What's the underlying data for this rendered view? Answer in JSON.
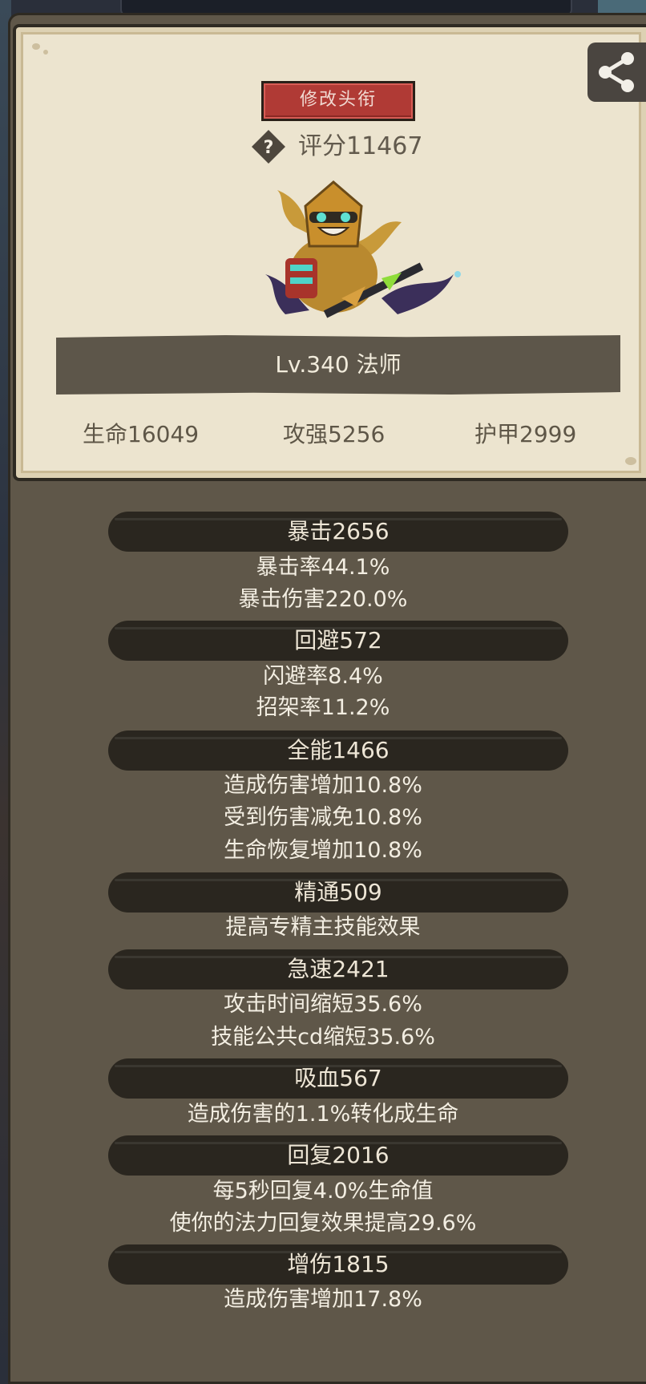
{
  "header": {
    "title_button": "修改头衔",
    "score_text": "评分11467"
  },
  "hero": {
    "level_class": "Lv.340 法师",
    "life": "生命16049",
    "attack": "攻强5256",
    "armor": "护甲2999"
  },
  "stats": [
    {
      "title": "暴击2656",
      "lines": [
        "暴击率44.1%",
        "暴击伤害220.0%"
      ]
    },
    {
      "title": "回避572",
      "lines": [
        "闪避率8.4%",
        "招架率11.2%"
      ]
    },
    {
      "title": "全能1466",
      "lines": [
        "造成伤害增加10.8%",
        "受到伤害减免10.8%",
        "生命恢复增加10.8%"
      ]
    },
    {
      "title": "精通509",
      "lines": [
        "提高专精主技能效果"
      ]
    },
    {
      "title": "急速2421",
      "lines": [
        "攻击时间缩短35.6%",
        "技能公共cd缩短35.6%"
      ]
    },
    {
      "title": "吸血567",
      "lines": [
        "造成伤害的1.1%转化成生命"
      ]
    },
    {
      "title": "回复2016",
      "lines": [
        "每5秒回复4.0%生命值",
        "使你的法力回复效果提高29.6%"
      ]
    },
    {
      "title": "增伤1815",
      "lines": [
        "造成伤害增加17.8%"
      ]
    }
  ],
  "icons": {
    "share": "share-icon",
    "help": "question-icon",
    "hero": "hero-portrait"
  },
  "colors": {
    "title_button": "#b03a35",
    "panel": "#5f5749",
    "parchment": "#ece4cf",
    "brush_bar": "#2a261f"
  }
}
